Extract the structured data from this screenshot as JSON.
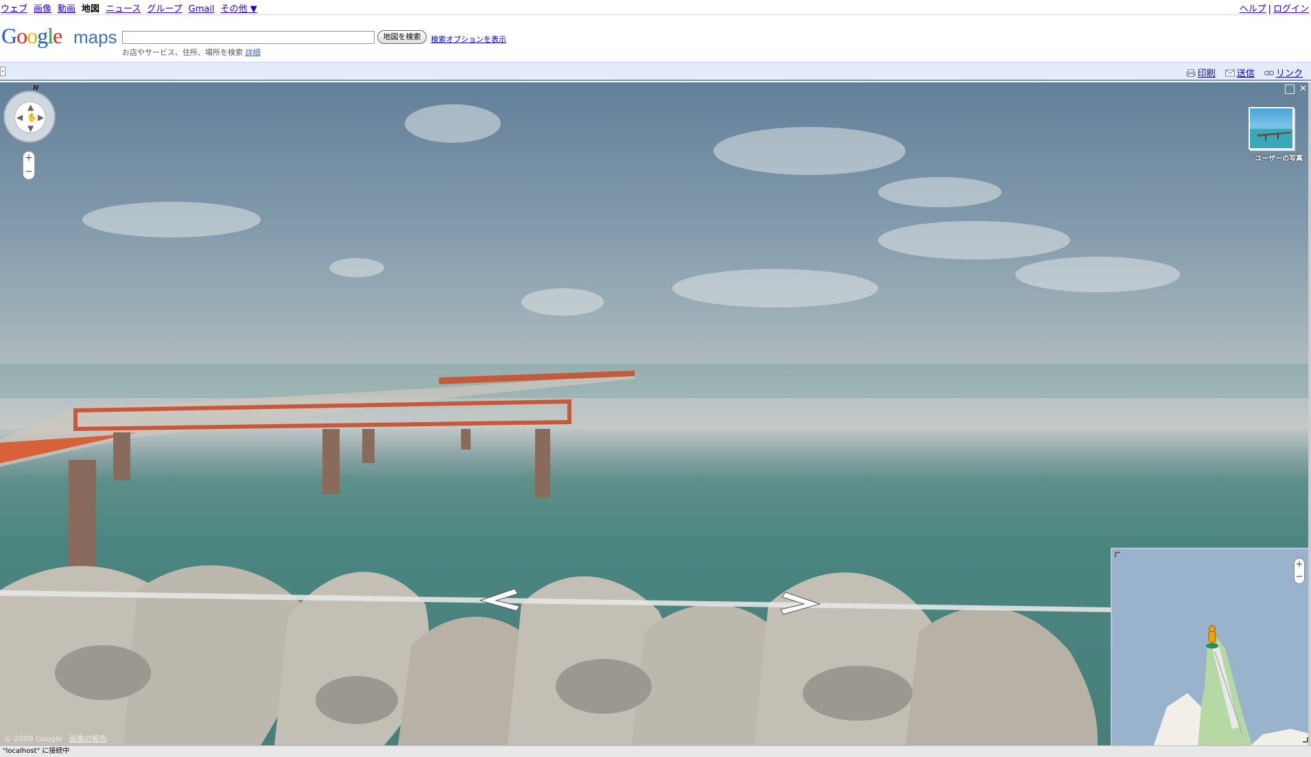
{
  "topbar": {
    "links": [
      "ウェブ",
      "画像",
      "動画"
    ],
    "current": "地図",
    "links2": [
      "ニュース",
      "グループ",
      "Gmail"
    ],
    "more": "その他 ▼",
    "help": "ヘルプ",
    "separator": "|",
    "login": "ログイン"
  },
  "header": {
    "logo_google": "Google",
    "logo_maps": "maps",
    "search_value": "",
    "search_button": "地図を検索",
    "search_options": "検索オプションを表示",
    "hint": "お店やサービス、住所、場所を検索",
    "hint_link": "詳細"
  },
  "toolbar": {
    "print": "印刷",
    "send": "送信",
    "link": "リンク",
    "icons": [
      "printer-icon",
      "envelope-icon",
      "link-icon"
    ]
  },
  "pano": {
    "compass_n": "N",
    "close": "✕",
    "user_photo_label": "ユーザーの写真",
    "copyright": "© 2009 Google",
    "report": "画像の報告"
  },
  "minimap": {
    "zoom_in": "+",
    "zoom_out": "−"
  },
  "status": {
    "text": "\"localhost\" に接続中"
  },
  "colors": {
    "link": "#2200cc",
    "toolbar_bg": "#e5ecf9",
    "sea": "#4b8580",
    "pier": "#d8613a"
  }
}
